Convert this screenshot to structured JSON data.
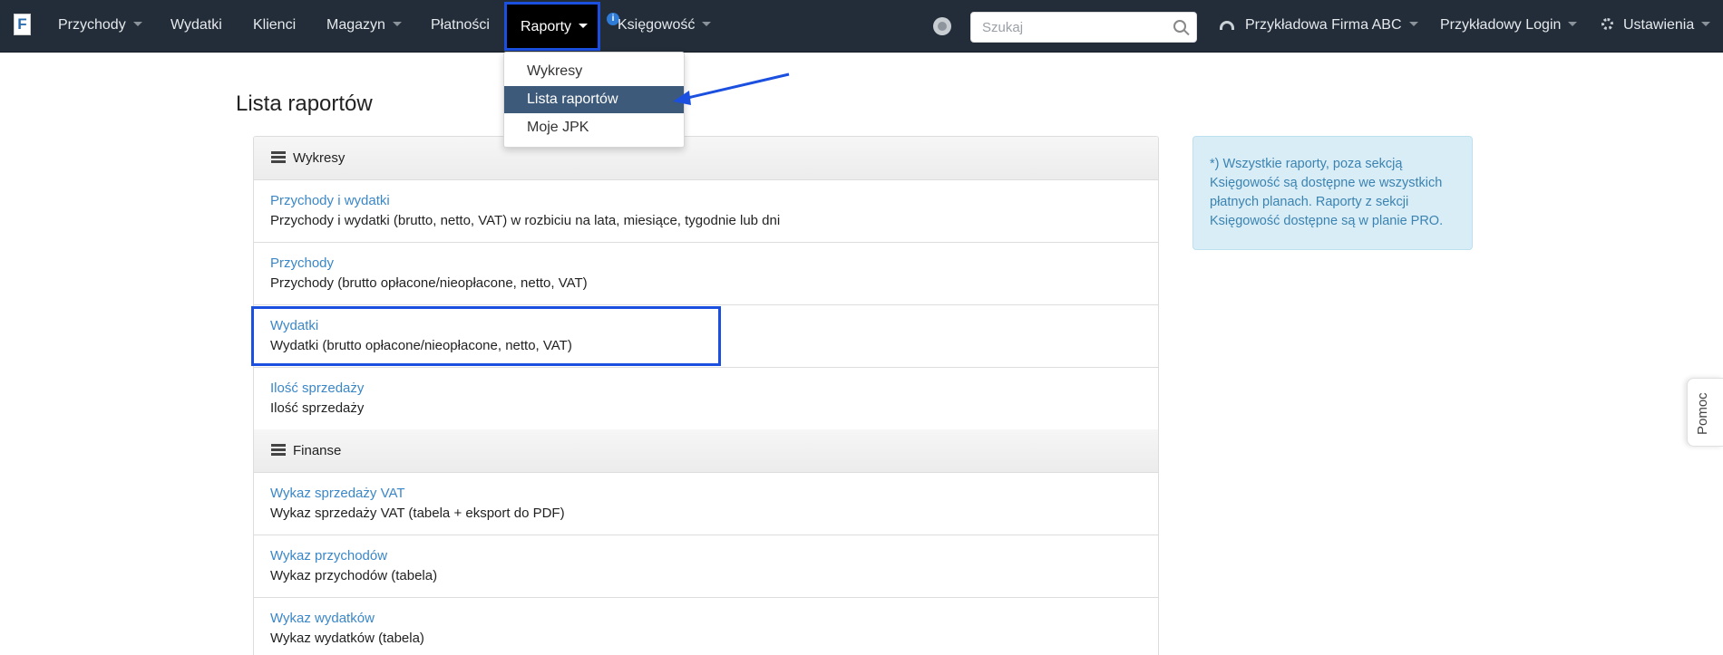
{
  "logo": "F",
  "nav": {
    "przychody": "Przychody",
    "wydatki": "Wydatki",
    "klienci": "Klienci",
    "magazyn": "Magazyn",
    "platnosci": "Płatności",
    "raporty": "Raporty",
    "ksiegowosc": "Księgowość",
    "info_badge": "i",
    "search_placeholder": "Szukaj",
    "company": "Przykładowa Firma ABC",
    "login": "Przykładowy Login",
    "settings": "Ustawienia"
  },
  "dropdown": {
    "items": [
      "Wykresy",
      "Lista raportów",
      "Moje JPK"
    ],
    "active_index": 1
  },
  "page": {
    "title": "Lista raportów"
  },
  "sections": [
    {
      "title": "Wykresy",
      "rows": [
        {
          "link": "Przychody i wydatki",
          "desc": "Przychody i wydatki (brutto, netto, VAT) w rozbiciu na lata, miesiące, tygodnie lub dni"
        },
        {
          "link": "Przychody",
          "desc": "Przychody (brutto opłacone/nieopłacone, netto, VAT)"
        },
        {
          "link": "Wydatki",
          "desc": "Wydatki (brutto opłacone/nieopłacone, netto, VAT)"
        },
        {
          "link": "Ilość sprzedaży",
          "desc": "Ilość sprzedaży"
        }
      ]
    },
    {
      "title": "Finanse",
      "rows": [
        {
          "link": "Wykaz sprzedaży VAT",
          "desc": "Wykaz sprzedaży VAT (tabela + eksport do PDF)"
        },
        {
          "link": "Wykaz przychodów",
          "desc": "Wykaz przychodów (tabela)"
        },
        {
          "link": "Wykaz wydatków",
          "desc": "Wykaz wydatków (tabela)"
        }
      ]
    }
  ],
  "info_box": "*) Wszystkie raporty, poza sekcją Księgowość są dostępne we wszystkich płatnych planach. Raporty z sekcji Księgowość dostępne są w planie PRO.",
  "help_tab": "Pomoc",
  "colors": {
    "navbar": "#222d39",
    "link": "#3a87c8",
    "dropdown_active": "#3e5a7a",
    "annotation": "#1a4fe0",
    "info_bg": "#d9edf7"
  }
}
